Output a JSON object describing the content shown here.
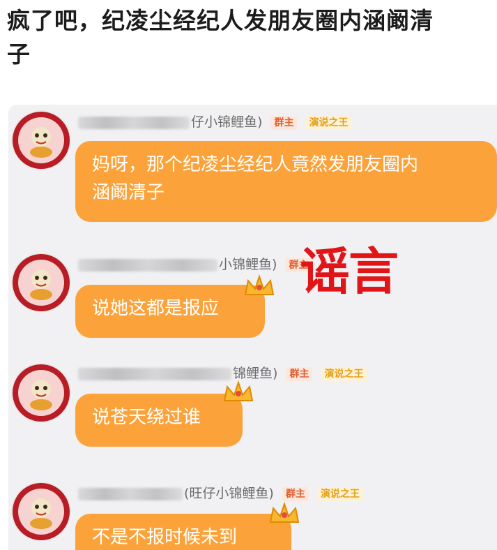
{
  "headline": {
    "line1": "疯了吧，纪凌尘经纪人发朋友圈内涵阚清",
    "line2": "子"
  },
  "messages": [
    {
      "name_suffix": "仔小锦鲤鱼)",
      "badges": [
        "群主",
        "演说之王"
      ],
      "text_line1": "妈呀，那个纪凌尘经纪人竟然发朋友圈内",
      "text_line2": "涵阚清子"
    },
    {
      "name_suffix": "小锦鲤鱼)",
      "badges": [
        "群主"
      ],
      "text_line1": "说她这都是报应"
    },
    {
      "name_suffix": "锦鲤鱼)",
      "badges": [
        "群主",
        "演说之王"
      ],
      "text_line1": "说苍天绕过谁"
    },
    {
      "name_suffix": "(旺仔小锦鲤鱼)",
      "badges": [
        "群主",
        "演说之王"
      ],
      "text_line1": "不是不报时候未到"
    }
  ],
  "stamp": "谣言",
  "colors": {
    "bubble": "#fba33a",
    "stamp": "#e11417",
    "avatar_ring": "#b81c25"
  }
}
